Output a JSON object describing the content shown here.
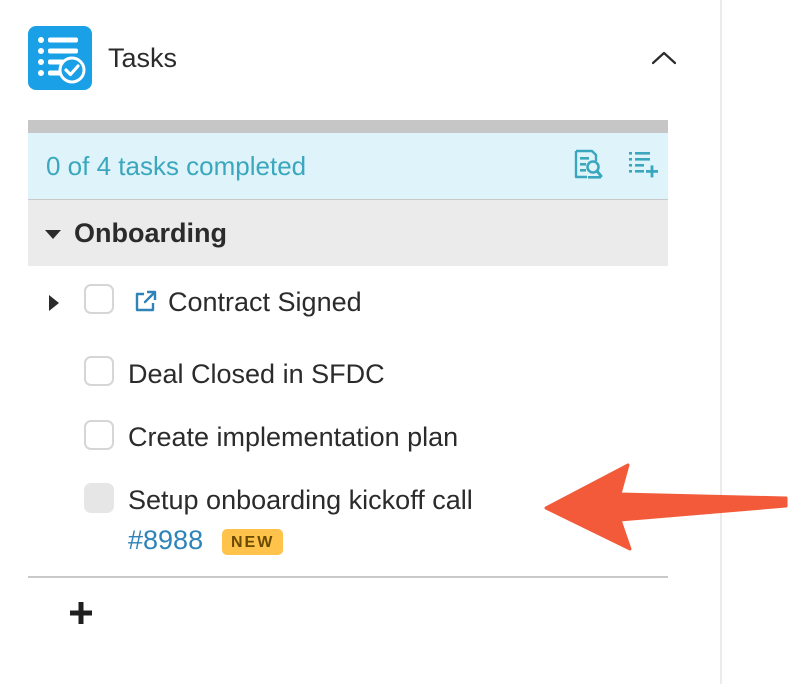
{
  "panel": {
    "title": "Tasks",
    "icons": {
      "app": "checklist-icon",
      "collapse": "chevron-up-icon"
    }
  },
  "summary": {
    "text": "0 of 4 tasks completed",
    "icons": [
      "search-document-icon",
      "add-list-icon"
    ]
  },
  "group": {
    "label": "Onboarding",
    "expanded": true
  },
  "tasks": [
    {
      "label": "Contract Signed",
      "checked": false,
      "has_subtasks": true,
      "external_link": true
    },
    {
      "label": "Deal Closed in SFDC",
      "checked": false
    },
    {
      "label": "Create implementation plan",
      "checked": false
    },
    {
      "label": "Setup onboarding kickoff call",
      "checked": false,
      "disabled": true,
      "issue": "#8988",
      "badge": "NEW"
    }
  ],
  "footer": {
    "add_icon": "plus-icon"
  },
  "colors": {
    "accent": "#1aa0e6",
    "summary_bg": "#dff4fa",
    "summary_text": "#3aa7bf",
    "link": "#2e83b8",
    "badge": "#ffc24a",
    "arrow": "#f25a3a"
  }
}
